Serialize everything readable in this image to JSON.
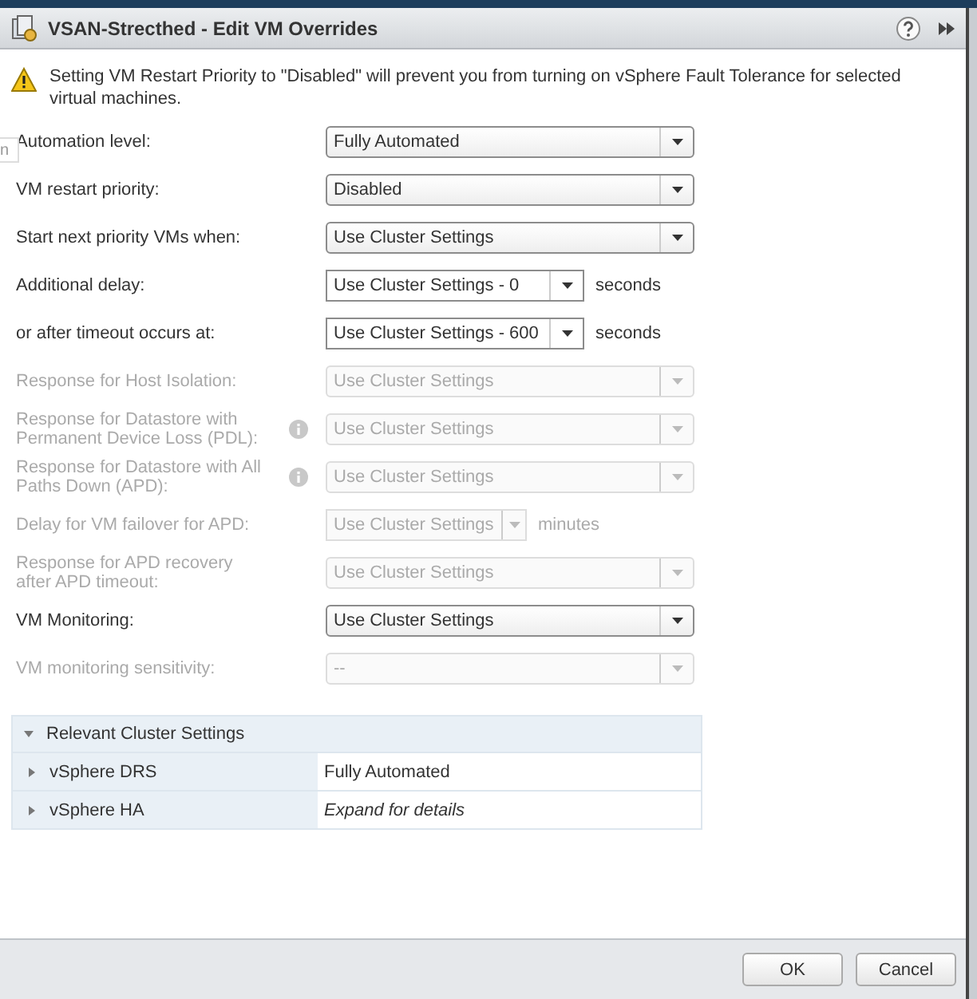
{
  "window": {
    "title": "VSAN-Strecthed - Edit VM Overrides"
  },
  "background_fragment": {
    "text": "n"
  },
  "warning": {
    "text": "Setting VM Restart Priority to \"Disabled\" will prevent you from turning on vSphere Fault Tolerance for selected virtual machines."
  },
  "fields": [
    {
      "label": "Automation level:",
      "value": "Fully Automated",
      "kind": "select",
      "disabled": false,
      "info": false
    },
    {
      "label": "VM restart priority:",
      "value": "Disabled",
      "kind": "select",
      "disabled": false,
      "info": false
    },
    {
      "label": "Start next priority VMs when:",
      "value": "Use Cluster Settings",
      "kind": "select",
      "disabled": false,
      "info": false
    },
    {
      "label": "Additional delay:",
      "value": "Use Cluster Settings - 0",
      "kind": "combo",
      "unit": "seconds",
      "disabled": false,
      "info": false
    },
    {
      "label": "or after timeout occurs at:",
      "value": "Use Cluster Settings - 600",
      "kind": "combo",
      "unit": "seconds",
      "disabled": false,
      "info": false
    },
    {
      "label": "Response for Host Isolation:",
      "value": "Use Cluster Settings",
      "kind": "select",
      "disabled": true,
      "info": false
    },
    {
      "label": "Response for Datastore with Permanent Device Loss (PDL):",
      "value": "Use Cluster Settings",
      "kind": "select",
      "disabled": true,
      "info": true
    },
    {
      "label": "Response for Datastore with All Paths Down (APD):",
      "value": "Use Cluster Settings",
      "kind": "select",
      "disabled": true,
      "info": true
    },
    {
      "label": "Delay for VM failover for APD:",
      "value": "Use Cluster Settings",
      "kind": "short",
      "unit": "minutes",
      "disabled": true,
      "info": false
    },
    {
      "label": "Response for APD recovery after APD timeout:",
      "value": "Use Cluster Settings",
      "kind": "select",
      "disabled": true,
      "info": false
    },
    {
      "label": "VM Monitoring:",
      "value": "Use Cluster Settings",
      "kind": "select",
      "disabled": false,
      "info": false
    },
    {
      "label": "VM monitoring sensitivity:",
      "value": "--",
      "kind": "select",
      "disabled": true,
      "info": false
    }
  ],
  "cluster_settings": {
    "title": "Relevant Cluster Settings",
    "expanded": true,
    "rows": [
      {
        "name": "vSphere DRS",
        "value": "Fully Automated",
        "expanded": false,
        "kind": "value"
      },
      {
        "name": "vSphere HA",
        "value": "Expand for details",
        "expanded": false,
        "kind": "hint"
      }
    ]
  },
  "buttons": [
    "OK",
    "Cancel"
  ]
}
